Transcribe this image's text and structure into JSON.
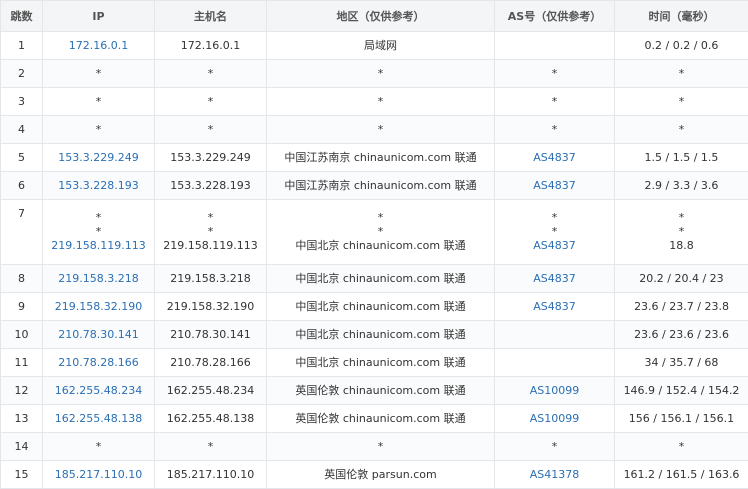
{
  "headers": [
    "跳数",
    "IP",
    "主机名",
    "地区（仅供参考）",
    "AS号（仅供参考）",
    "时间（毫秒）"
  ],
  "rows": [
    {
      "hop": "1",
      "ip": [
        "172.16.0.1"
      ],
      "host": [
        "172.16.0.1"
      ],
      "region": [
        "局域网"
      ],
      "as": [
        ""
      ],
      "time": [
        "0.2 / 0.2 / 0.6"
      ]
    },
    {
      "hop": "2",
      "ip": [
        "*"
      ],
      "host": [
        "*"
      ],
      "region": [
        "*"
      ],
      "as": [
        "*"
      ],
      "time": [
        "*"
      ]
    },
    {
      "hop": "3",
      "ip": [
        "*"
      ],
      "host": [
        "*"
      ],
      "region": [
        "*"
      ],
      "as": [
        "*"
      ],
      "time": [
        "*"
      ]
    },
    {
      "hop": "4",
      "ip": [
        "*"
      ],
      "host": [
        "*"
      ],
      "region": [
        "*"
      ],
      "as": [
        "*"
      ],
      "time": [
        "*"
      ]
    },
    {
      "hop": "5",
      "ip": [
        "153.3.229.249"
      ],
      "host": [
        "153.3.229.249"
      ],
      "region": [
        "中国江苏南京 chinaunicom.com 联通"
      ],
      "as": [
        "AS4837"
      ],
      "time": [
        "1.5 / 1.5 / 1.5"
      ]
    },
    {
      "hop": "6",
      "ip": [
        "153.3.228.193"
      ],
      "host": [
        "153.3.228.193"
      ],
      "region": [
        "中国江苏南京 chinaunicom.com 联通"
      ],
      "as": [
        "AS4837"
      ],
      "time": [
        "2.9 / 3.3 / 3.6"
      ]
    },
    {
      "hop": "7",
      "ip": [
        "*",
        "*",
        "219.158.119.113"
      ],
      "host": [
        "*",
        "*",
        "219.158.119.113"
      ],
      "region": [
        "*",
        "*",
        "中国北京 chinaunicom.com 联通"
      ],
      "as": [
        "*",
        "*",
        "AS4837"
      ],
      "time": [
        "*",
        "*",
        "18.8"
      ]
    },
    {
      "hop": "8",
      "ip": [
        "219.158.3.218"
      ],
      "host": [
        "219.158.3.218"
      ],
      "region": [
        "中国北京 chinaunicom.com 联通"
      ],
      "as": [
        "AS4837"
      ],
      "time": [
        "20.2 / 20.4 / 23"
      ]
    },
    {
      "hop": "9",
      "ip": [
        "219.158.32.190"
      ],
      "host": [
        "219.158.32.190"
      ],
      "region": [
        "中国北京 chinaunicom.com 联通"
      ],
      "as": [
        "AS4837"
      ],
      "time": [
        "23.6 / 23.7 / 23.8"
      ]
    },
    {
      "hop": "10",
      "ip": [
        "210.78.30.141"
      ],
      "host": [
        "210.78.30.141"
      ],
      "region": [
        "中国北京 chinaunicom.com 联通"
      ],
      "as": [
        ""
      ],
      "time": [
        "23.6 / 23.6 / 23.6"
      ]
    },
    {
      "hop": "11",
      "ip": [
        "210.78.28.166"
      ],
      "host": [
        "210.78.28.166"
      ],
      "region": [
        "中国北京 chinaunicom.com 联通"
      ],
      "as": [
        ""
      ],
      "time": [
        "34 / 35.7 / 68"
      ]
    },
    {
      "hop": "12",
      "ip": [
        "162.255.48.234"
      ],
      "host": [
        "162.255.48.234"
      ],
      "region": [
        "英国伦敦 chinaunicom.com 联通"
      ],
      "as": [
        "AS10099"
      ],
      "time": [
        "146.9 / 152.4 / 154.2"
      ]
    },
    {
      "hop": "13",
      "ip": [
        "162.255.48.138"
      ],
      "host": [
        "162.255.48.138"
      ],
      "region": [
        "英国伦敦 chinaunicom.com 联通"
      ],
      "as": [
        "AS10099"
      ],
      "time": [
        "156 / 156.1 / 156.1"
      ]
    },
    {
      "hop": "14",
      "ip": [
        "*"
      ],
      "host": [
        "*"
      ],
      "region": [
        "*"
      ],
      "as": [
        "*"
      ],
      "time": [
        "*"
      ]
    },
    {
      "hop": "15",
      "ip": [
        "185.217.110.10"
      ],
      "host": [
        "185.217.110.10"
      ],
      "region": [
        "英国伦敦 parsun.com"
      ],
      "as": [
        "AS41378"
      ],
      "time": [
        "161.2 / 161.5 / 163.6"
      ]
    }
  ]
}
